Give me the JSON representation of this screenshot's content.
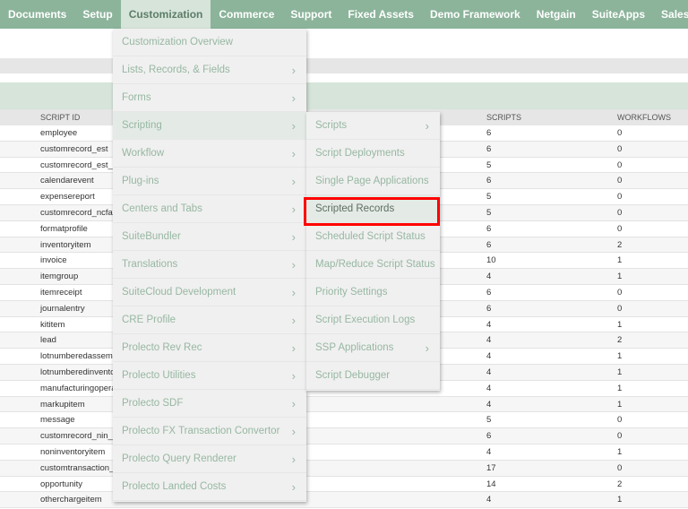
{
  "nav": [
    "Documents",
    "Setup",
    "Customization",
    "Commerce",
    "Support",
    "Fixed Assets",
    "Demo Framework",
    "Netgain",
    "SuiteApps",
    "Sales"
  ],
  "table": {
    "headers": [
      "SCRIPT ID",
      "SCRIPTS",
      "WORKFLOWS"
    ],
    "rows": [
      [
        "employee",
        "6",
        "0"
      ],
      [
        "customrecord_est",
        "6",
        "0"
      ],
      [
        "customrecord_est_s",
        "5",
        "0"
      ],
      [
        "calendarevent",
        "6",
        "0"
      ],
      [
        "expensereport",
        "5",
        "0"
      ],
      [
        "customrecord_ncfar",
        "5",
        "0"
      ],
      [
        "formatprofile",
        "6",
        "0"
      ],
      [
        "inventoryitem",
        "6",
        "2"
      ],
      [
        "invoice",
        "10",
        "1"
      ],
      [
        "itemgroup",
        "4",
        "1"
      ],
      [
        "itemreceipt",
        "6",
        "0"
      ],
      [
        "journalentry",
        "6",
        "0"
      ],
      [
        "kititem",
        "4",
        "1"
      ],
      [
        "lead",
        "4",
        "2"
      ],
      [
        "lotnumberedassembly",
        "4",
        "1"
      ],
      [
        "lotnumberedinventory",
        "4",
        "1"
      ],
      [
        "manufacturingoperation",
        "4",
        "1"
      ],
      [
        "markupitem",
        "4",
        "1"
      ],
      [
        "message",
        "5",
        "0"
      ],
      [
        "customrecord_nin_",
        "6",
        "0"
      ],
      [
        "noninventoryitem",
        "4",
        "1"
      ],
      [
        "customtransaction_",
        "17",
        "0"
      ],
      [
        "opportunity",
        "14",
        "2"
      ],
      [
        "otherchargeitem",
        "4",
        "1"
      ]
    ]
  },
  "menu": [
    {
      "label": "Customization Overview",
      "sub": false
    },
    {
      "label": "Lists, Records, & Fields",
      "sub": true
    },
    {
      "label": "Forms",
      "sub": true
    },
    {
      "label": "Scripting",
      "sub": true
    },
    {
      "label": "Workflow",
      "sub": true
    },
    {
      "label": "Plug-ins",
      "sub": true
    },
    {
      "label": "Centers and Tabs",
      "sub": true
    },
    {
      "label": "SuiteBundler",
      "sub": true
    },
    {
      "label": "Translations",
      "sub": true
    },
    {
      "label": "SuiteCloud Development",
      "sub": true
    },
    {
      "label": "CRE Profile",
      "sub": true
    },
    {
      "label": "Prolecto Rev Rec",
      "sub": true
    },
    {
      "label": "Prolecto Utilities",
      "sub": true
    },
    {
      "label": "Prolecto SDF",
      "sub": true
    },
    {
      "label": "Prolecto FX Transaction Convertor",
      "sub": true
    },
    {
      "label": "Prolecto Query Renderer",
      "sub": true
    },
    {
      "label": "Prolecto Landed Costs",
      "sub": true
    }
  ],
  "submenu": [
    {
      "label": "Scripts",
      "sub": true
    },
    {
      "label": "Script Deployments",
      "sub": false
    },
    {
      "label": "Single Page Applications",
      "sub": false
    },
    {
      "label": "Scripted Records",
      "sub": false
    },
    {
      "label": "Scheduled Script Status",
      "sub": false
    },
    {
      "label": "Map/Reduce Script Status",
      "sub": false
    },
    {
      "label": "Priority Settings",
      "sub": false
    },
    {
      "label": "Script Execution Logs",
      "sub": false
    },
    {
      "label": "SSP Applications",
      "sub": true
    },
    {
      "label": "Script Debugger",
      "sub": false
    }
  ],
  "chevron": "›"
}
